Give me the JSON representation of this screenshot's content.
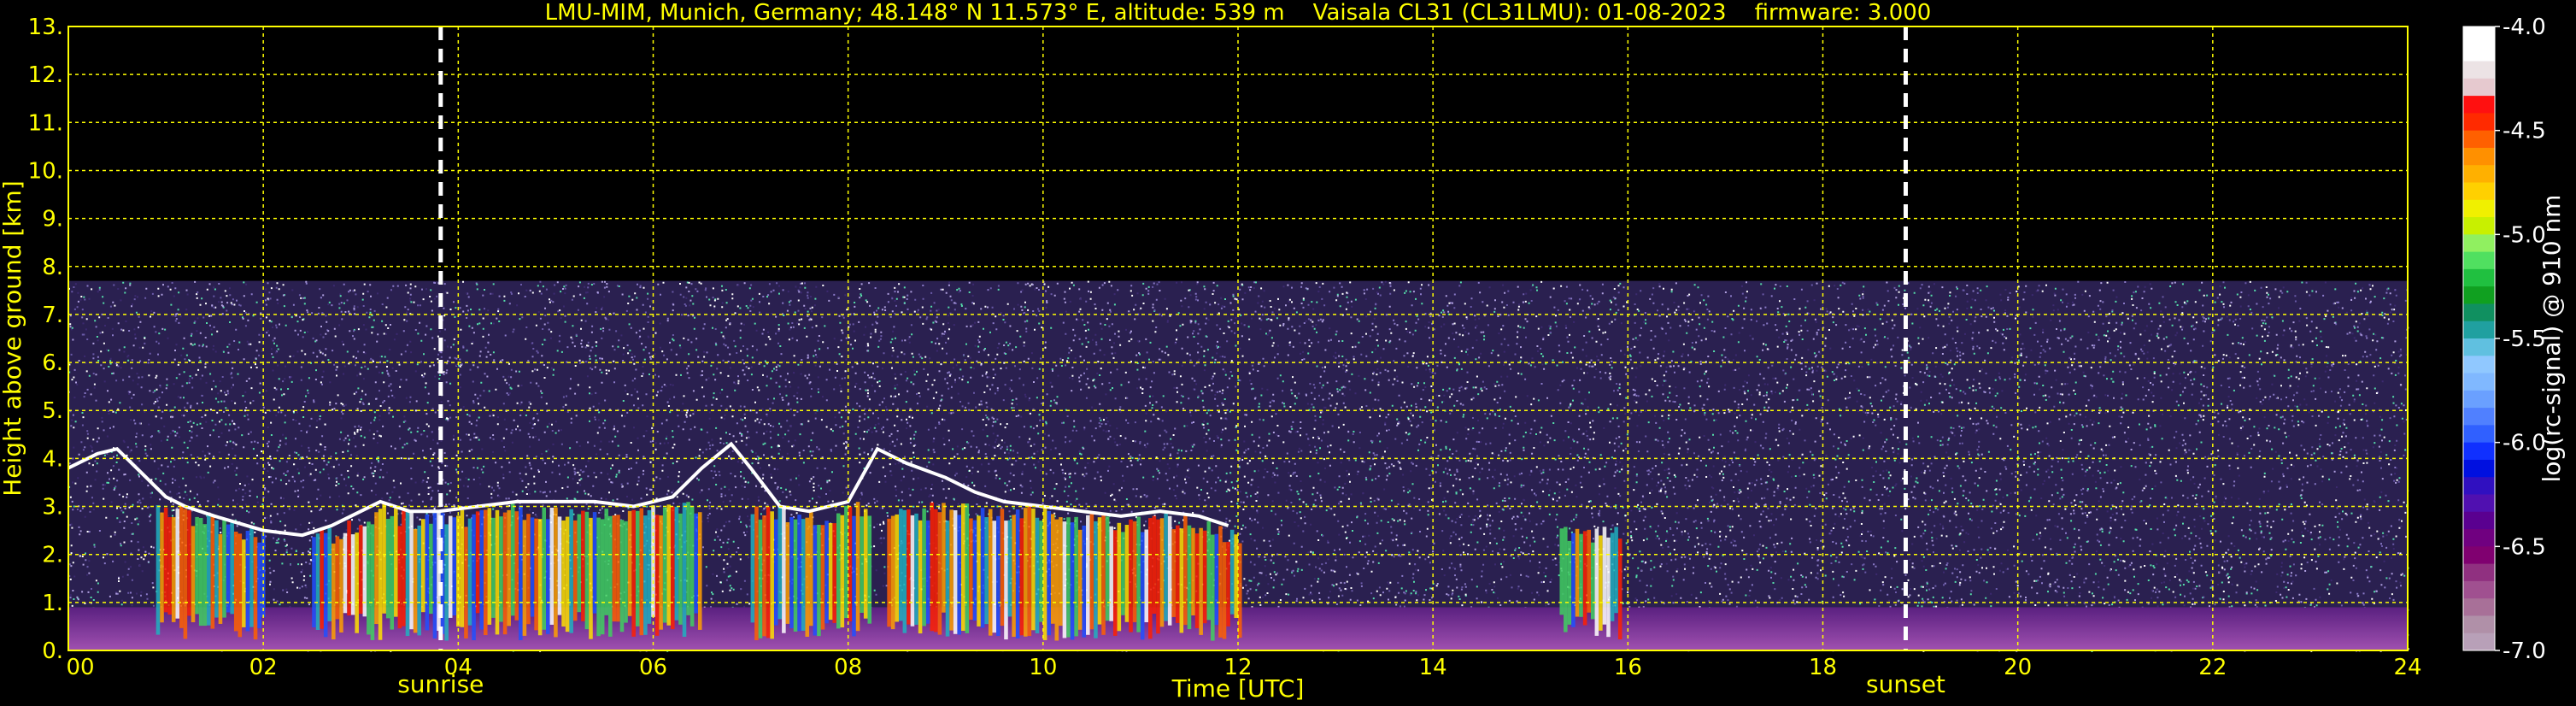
{
  "chart_data": {
    "type": "heatmap",
    "title": "LMU-MIM, Munich, Germany; 48.148° N 11.573° E, altitude: 539 m    Vaisala CL31 (CL31LMU): 01-08-2023    firmware: 3.000",
    "xlabel": "Time [UTC]",
    "ylabel": "Height above ground [km]",
    "xlim": [
      0,
      24
    ],
    "ylim": [
      0,
      13
    ],
    "x_ticks": [
      "00",
      "02",
      "04",
      "06",
      "08",
      "10",
      "12",
      "14",
      "16",
      "18",
      "20",
      "22",
      "24"
    ],
    "y_ticks": [
      "0.",
      "1.",
      "2.",
      "3.",
      "4.",
      "5.",
      "6.",
      "7.",
      "8.",
      "9.",
      "10.",
      "11.",
      "12.",
      "13."
    ],
    "grid": true,
    "grid_color": "#ffff00",
    "data_max_height_km": 7.7,
    "vertical_markers": [
      {
        "label": "sunrise",
        "x": 3.82
      },
      {
        "label": "sunset",
        "x": 18.85
      }
    ],
    "colorbar": {
      "label": "log(rc-signal) @ 910 nm",
      "range": [
        -7.0,
        -4.0
      ],
      "ticks": [
        "-4.0",
        "-4.5",
        "-5.0",
        "-5.5",
        "-6.0",
        "-6.5",
        "-7.0"
      ],
      "colors": [
        "#ffffff",
        "#ffffff",
        "#ece3e5",
        "#e6c9cf",
        "#ff1010",
        "#ff2a00",
        "#ff6000",
        "#ff9000",
        "#ffb000",
        "#ffd000",
        "#f0f000",
        "#c8f000",
        "#90f060",
        "#50e060",
        "#20c040",
        "#10a020",
        "#109060",
        "#20a0a0",
        "#60c0e0",
        "#90c8ff",
        "#80b8ff",
        "#6aa0ff",
        "#5080ff",
        "#3060ff",
        "#1030ff",
        "#0010e0",
        "#3010c0",
        "#5010b0",
        "#5a0090",
        "#700080",
        "#800070",
        "#903080",
        "#a05090",
        "#a87098",
        "#b090a8",
        "#b8a0b8"
      ]
    },
    "regions": [
      {
        "kind": "boundary_layer_top",
        "x": [
          0.0,
          0.3,
          0.5,
          0.8,
          1.0,
          1.2,
          1.5,
          2.0,
          2.4,
          2.7,
          3.0,
          3.2,
          3.5,
          3.8,
          4.2,
          4.6,
          5.0,
          5.4,
          5.8,
          6.2,
          6.5,
          6.8,
          7.0,
          7.3,
          7.6,
          7.8,
          8.0,
          8.3,
          8.6,
          9.0,
          9.3,
          9.6,
          10.0,
          10.4,
          10.8,
          11.2,
          11.6,
          11.9
        ],
        "y": [
          3.8,
          4.1,
          4.2,
          3.6,
          3.2,
          3.0,
          2.8,
          2.5,
          2.4,
          2.6,
          2.9,
          3.1,
          2.9,
          2.9,
          3.0,
          3.1,
          3.1,
          3.1,
          3.0,
          3.2,
          3.8,
          4.3,
          3.8,
          3.0,
          2.9,
          3.0,
          3.1,
          4.2,
          3.9,
          3.6,
          3.3,
          3.1,
          3.0,
          2.9,
          2.8,
          2.9,
          2.8,
          2.6
        ]
      },
      {
        "kind": "strong_aerosol",
        "from": 0.9,
        "to": 2.0
      },
      {
        "kind": "strong_aerosol",
        "from": 2.5,
        "to": 6.5
      },
      {
        "kind": "strong_aerosol",
        "from": 7.0,
        "to": 8.2
      },
      {
        "kind": "strong_aerosol",
        "from": 8.4,
        "to": 12.0
      },
      {
        "kind": "strong_aerosol",
        "from": 15.3,
        "to": 15.9
      }
    ]
  }
}
